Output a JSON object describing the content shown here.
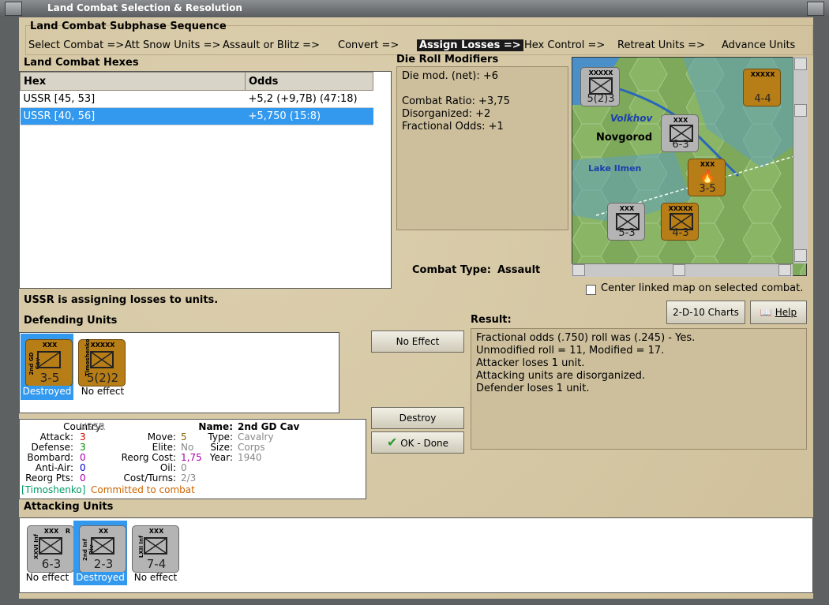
{
  "window": {
    "title": "Land Combat Selection & Resolution"
  },
  "sequence": {
    "heading": "Land Combat Subphase Sequence",
    "steps": [
      "Select Combat =>",
      "Att Snow Units =>",
      "Assault or Blitz =>",
      "Convert =>",
      "Assign Losses =>",
      "Hex Control =>",
      "Retreat Units =>",
      "Advance Units"
    ],
    "active_index": 4
  },
  "hexes": {
    "heading": "Land Combat Hexes",
    "columns": [
      "Hex",
      "Odds"
    ],
    "rows": [
      {
        "hex": "USSR [45, 53]",
        "odds": "+5,2 (+9,7B) (47:18)"
      },
      {
        "hex": "USSR [40, 56]",
        "odds": "+5,750 (15:8)"
      }
    ],
    "selected_index": 1
  },
  "modifiers": {
    "heading": "Die Roll Modifiers",
    "lines": [
      "Die mod. (net): +6",
      "",
      "Combat Ratio: +3,75",
      "Disorganized: +2",
      "Fractional Odds: +1"
    ]
  },
  "combat_type": {
    "label": "Combat Type:",
    "value": "Assault"
  },
  "map": {
    "labels": {
      "volkhov": "Volkhov",
      "novgorod": "Novgorod",
      "lake": "Lake Ilmen"
    },
    "counters": [
      {
        "size": "XXXXX",
        "side": "",
        "strength": "5(2)3",
        "color": "gray"
      },
      {
        "size": "XXXXX",
        "side": "",
        "strength": "4-4",
        "color": "brown"
      },
      {
        "size": "XXX",
        "side": "",
        "strength": "6-3",
        "color": "gray"
      },
      {
        "size": "XXX",
        "side": "",
        "strength": "3-5",
        "color": "brown"
      },
      {
        "size": "XXX",
        "side": "",
        "strength": "5-3",
        "color": "gray"
      },
      {
        "size": "XXXXX",
        "side": "",
        "strength": "4-3",
        "color": "brown"
      }
    ]
  },
  "center_linked": {
    "label": "Center linked map on selected combat.",
    "checked": false
  },
  "buttons": {
    "charts": "2-D-10 Charts",
    "help": "Help",
    "no_effect": "No Effect",
    "destroy": "Destroy",
    "done": "OK - Done"
  },
  "status": "USSR is assigning losses to units.",
  "defending": {
    "heading": "Defending Units",
    "units": [
      {
        "size": "XXX",
        "side": "2nd GD Cav",
        "strength": "3-5",
        "result": "Destroyed",
        "selected": true
      },
      {
        "size": "XXXXX",
        "side": "Timoshenko",
        "strength": "5(2)2",
        "result": "No effect",
        "selected": false
      }
    ]
  },
  "result": {
    "heading": "Result:",
    "lines": [
      "Fractional odds (.750) roll was (.245)  - Yes.",
      "Unmodified roll = 11, Modified = 17.",
      "Attacker loses 1 unit.",
      "Attacking units are disorganized.",
      "Defender loses 1 unit."
    ]
  },
  "unit_info": {
    "country_label": "Country:",
    "country": "USSR",
    "attack_label": "Attack:",
    "attack": "3",
    "defense_label": "Defense:",
    "defense": "3",
    "bombard_label": "Bombard:",
    "bombard": "0",
    "antiair_label": "Anti-Air:",
    "antiair": "0",
    "reorgpts_label": "Reorg Pts:",
    "reorgpts": "0",
    "move_label": "Move:",
    "move": "5",
    "elite_label": "Elite:",
    "elite": "No",
    "reorgcost_label": "Reorg Cost:",
    "reorgcost": "1,75",
    "oil_label": "Oil:",
    "oil": "0",
    "costturns_label": "Cost/Turns:",
    "costturns": "2/3",
    "name_label": "Name:",
    "name": "2nd GD Cav",
    "type_label": "Type:",
    "type": "Cavalry",
    "size_label": "Size:",
    "size": "Corps",
    "year_label": "Year:",
    "year": "1940",
    "hq": "[Timoshenko]",
    "status": "Committed to combat",
    "colors": {
      "attack": "#cc0000",
      "defense": "#008800",
      "bombard": "#aa00aa",
      "antiair": "#0000cc",
      "reorgpts": "#aa00aa",
      "move": "#886600",
      "reorgcost": "#aa00aa",
      "gray": "#888888",
      "hq": "#009966",
      "status": "#cc6600"
    }
  },
  "attacking": {
    "heading": "Attacking Units",
    "units": [
      {
        "size": "XXX",
        "side": "XXVI Inf",
        "strength": "6-3",
        "result": "No effect",
        "selected": false,
        "flag": "R"
      },
      {
        "size": "XX",
        "side": "2nd Inf Div",
        "strength": "2-3",
        "result": "Destroyed",
        "selected": true,
        "flag": ""
      },
      {
        "size": "XXX",
        "side": "LXII Inf",
        "strength": "7-4",
        "result": "No effect",
        "selected": false,
        "flag": ""
      }
    ]
  }
}
